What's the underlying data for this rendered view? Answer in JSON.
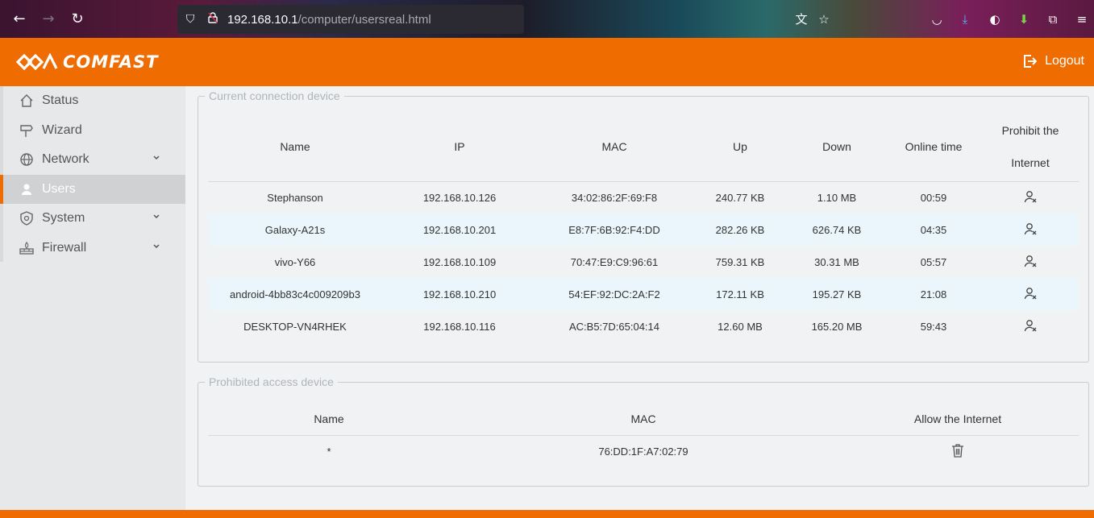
{
  "browser": {
    "url_host": "192.168.10.1",
    "url_path": "/computer/usersreal.html"
  },
  "header": {
    "brand": "COMFAST",
    "logout_label": "Logout",
    "accent_color": "#ee6c00"
  },
  "sidebar": {
    "items": [
      {
        "label": "Status",
        "icon": "home-icon"
      },
      {
        "label": "Wizard",
        "icon": "signpost-icon"
      },
      {
        "label": "Network",
        "icon": "globe-icon",
        "expandable": true
      },
      {
        "label": "Users",
        "icon": "user-icon",
        "active": true
      },
      {
        "label": "System",
        "icon": "shield-gear-icon",
        "expandable": true
      },
      {
        "label": "Firewall",
        "icon": "firewall-icon",
        "expandable": true
      }
    ]
  },
  "connected": {
    "legend": "Current connection device",
    "headers": [
      "Name",
      "IP",
      "MAC",
      "Up",
      "Down",
      "Online time",
      "Prohibit the",
      "Internet"
    ],
    "rows": [
      [
        "Stephanson",
        "192.168.10.126",
        "34:02:86:2F:69:F8",
        "240.77 KB",
        "1.10 MB",
        "00:59"
      ],
      [
        "Galaxy-A21s",
        "192.168.10.201",
        "E8:7F:6B:92:F4:DD",
        "282.26 KB",
        "626.74 KB",
        "04:35"
      ],
      [
        "vivo-Y66",
        "192.168.10.109",
        "70:47:E9:C9:96:61",
        "759.31 KB",
        "30.31 MB",
        "05:57"
      ],
      [
        "android-4bb83c4c009209b3",
        "192.168.10.210",
        "54:EF:92:DC:2A:F2",
        "172.11 KB",
        "195.27 KB",
        "21:08"
      ],
      [
        "DESKTOP-VN4RHEK",
        "192.168.10.116",
        "AC:B5:7D:65:04:14",
        "12.60 MB",
        "165.20 MB",
        "59:43"
      ]
    ]
  },
  "prohibited": {
    "legend": "Prohibited access device",
    "headers": [
      "Name",
      "MAC",
      "Allow the Internet"
    ],
    "rows": [
      [
        "*",
        "76:DD:1F:A7:02:79"
      ]
    ]
  }
}
